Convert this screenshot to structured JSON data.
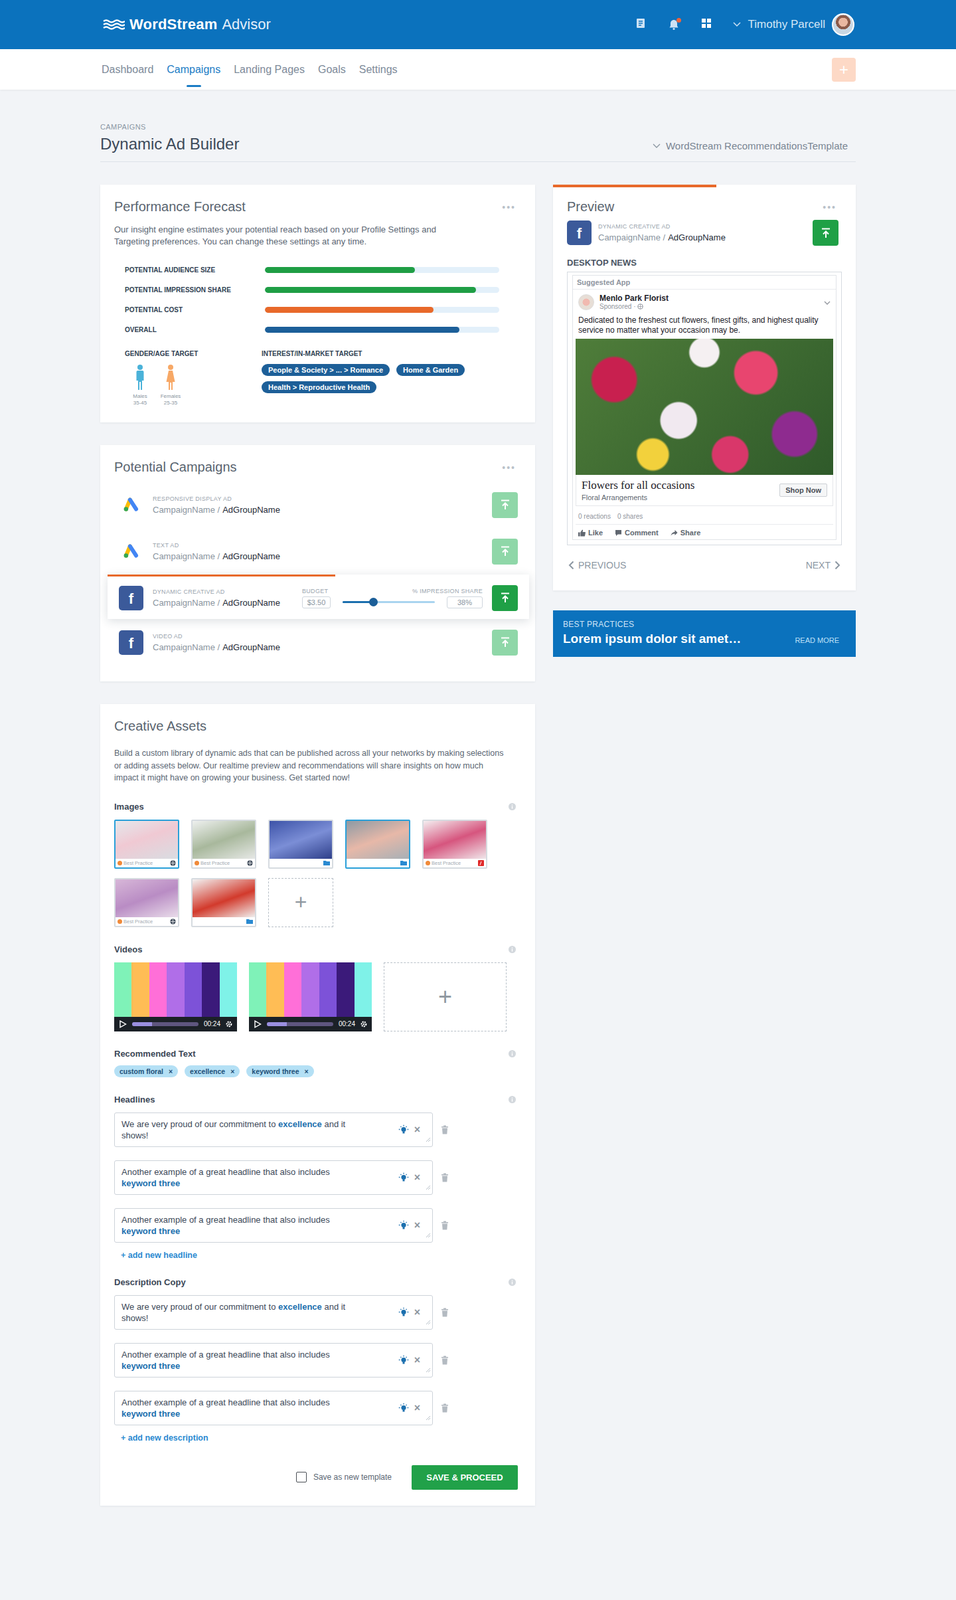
{
  "topbar": {
    "logo_bold": "WordStream",
    "logo_light": "Advisor",
    "user": "Timothy Parcell",
    "notification_unread": true
  },
  "nav": {
    "tabs": [
      {
        "label": "Dashboard",
        "selected": false
      },
      {
        "label": "Campaigns",
        "selected": true
      },
      {
        "label": "Landing Pages",
        "selected": false
      },
      {
        "label": "Goals",
        "selected": false
      },
      {
        "label": "Settings",
        "selected": false
      }
    ],
    "action": "+"
  },
  "header": {
    "breadcrumb": "CAMPAIGNS",
    "title": "Dynamic Ad Builder",
    "template": "WordStream RecommendationsTemplate"
  },
  "forecast": {
    "title": "Performance Forecast",
    "more": "•••",
    "description": "Our insight engine estimates your potential reach based on your Profile Settings and Targeting preferences. You can change these settings at any time.",
    "metrics": [
      {
        "label": "POTENTIAL AUDIENCE SIZE",
        "level": 0.64,
        "color": "#1f9e45"
      },
      {
        "label": "POTENTIAL IMPRESSION SHARE",
        "level": 0.9,
        "color": "#1f9e45"
      },
      {
        "label": "POTENTIAL COST",
        "level": 0.72,
        "color": "#e8692a"
      },
      {
        "label": "OVERALL",
        "level": 0.83,
        "color": "#1c5f99"
      }
    ],
    "gender_title": "GENDER/AGE TARGET",
    "genders": [
      {
        "label": "Males",
        "age": "35-45",
        "color": "#4ab2d9"
      },
      {
        "label": "Females",
        "age": "25-35",
        "color": "#f7a866"
      }
    ],
    "interest_title": "INTEREST/IN-MARKET TARGET",
    "interests": [
      "People & Society > ... > Romance",
      "Home & Garden",
      "Health > Reproductive Health"
    ]
  },
  "campaigns": {
    "title": "Potential Campaigns",
    "more": "•••",
    "items": [
      {
        "kind": "google",
        "type": "RESPONSIVE DISPLAY AD",
        "campaign": "CampaignName /",
        "ad_group": "AdGroupName",
        "selected": false
      },
      {
        "kind": "google",
        "type": "TEXT AD",
        "campaign": "CampaignName /",
        "ad_group": "AdGroupName",
        "selected": false
      },
      {
        "kind": "facebook",
        "icon": "f",
        "type": "DYNAMIC CREATIVE AD",
        "campaign": "CampaignName /",
        "ad_group": "AdGroupName",
        "selected": true,
        "progress": 0.54,
        "budget_label": "BUDGET",
        "budget": "$3.50",
        "budget_level": 0.34,
        "share_label": "% IMPRESSION SHARE",
        "share": "38%"
      },
      {
        "kind": "facebook",
        "icon": "f",
        "type": "VIDEO AD",
        "campaign": "CampaignName /",
        "ad_group": "AdGroupName",
        "selected": false
      }
    ]
  },
  "preview": {
    "progress": 0.54,
    "title": "Preview",
    "more": "•••",
    "ad": {
      "icon": "f",
      "type": "DYNAMIC CREATIVE AD",
      "campaign": "CampaignName /",
      "ad_group": "AdGroupName"
    },
    "placement": "DESKTOP NEWS",
    "post": {
      "suggested": "Suggested App",
      "page": "Menlo Park Florist",
      "sponsored": "Sponsored ·",
      "text": "Dedicated to the freshest cut flowers, finest gifts, and highest quality service no matter what your occasion may be.",
      "link_title": "Flowers for all occasions",
      "link_caption": "Floral Arrangements",
      "cta": "Shop Now",
      "reactions": "0 reactions",
      "shares": "0 shares",
      "actions": [
        "Like",
        "Comment",
        "Share"
      ]
    },
    "previous": "PREVIOUS",
    "next": "NEXT"
  },
  "best_practices": {
    "label": "BEST PRACTICES",
    "text": "Lorem ipsum dolor sit amet…",
    "link": "READ MORE"
  },
  "creative": {
    "title": "Creative Assets",
    "description": "Build a custom library of dynamic ads that can be published across all your networks by making selections or adding assets below. Our realtime preview and recommendations will share insights on how much impact it might have on growing your business. Get started now!",
    "images": {
      "title": "Images",
      "add": "+",
      "items": [
        {
          "selected": true,
          "badge": "Best Practice",
          "kind": "web"
        },
        {
          "selected": false,
          "badge": "Best Practice",
          "kind": "web"
        },
        {
          "selected": false,
          "kind": "folder"
        },
        {
          "selected": true,
          "kind": "folder"
        },
        {
          "selected": false,
          "badge": "Best Practice",
          "kind": "pinterest"
        },
        {
          "selected": false,
          "badge": "Best Practice",
          "kind": "web"
        },
        {
          "selected": false,
          "kind": "folder"
        }
      ]
    },
    "videos": {
      "title": "Videos",
      "add": "+",
      "items": [
        {
          "time": "00:24",
          "level": 0.3
        },
        {
          "time": "00:24",
          "level": 0.3
        }
      ]
    },
    "recommended": {
      "title": "Recommended Text",
      "remove": "×",
      "chips": [
        "custom floral",
        "excellence",
        "keyword three"
      ]
    },
    "headlines": {
      "title": "Headlines",
      "clear": "×",
      "add": "+ add new headline",
      "fields": [
        {
          "parts": [
            {
              "text": "We are very proud of our commitment to ",
              "keyword": false
            },
            {
              "text": "excellence",
              "keyword": true
            },
            {
              "text": " and it shows!",
              "keyword": false
            }
          ]
        },
        {
          "parts": [
            {
              "text": "Another example of a great headline that also includes ",
              "keyword": false
            },
            {
              "text": "keyword three",
              "keyword": true
            }
          ]
        },
        {
          "parts": [
            {
              "text": "Another example of a great headline that also includes ",
              "keyword": false
            },
            {
              "text": "keyword three",
              "keyword": true
            }
          ]
        }
      ]
    },
    "descriptions": {
      "title": "Description Copy",
      "clear": "×",
      "add": "+ add new description",
      "fields": [
        {
          "parts": [
            {
              "text": "We are very proud of our commitment to ",
              "keyword": false
            },
            {
              "text": "excellence",
              "keyword": true
            },
            {
              "text": " and it shows!",
              "keyword": false
            }
          ]
        },
        {
          "parts": [
            {
              "text": "Another example of a great headline that also includes ",
              "keyword": false
            },
            {
              "text": "keyword three",
              "keyword": true
            }
          ]
        },
        {
          "parts": [
            {
              "text": "Another example of a great headline that also includes ",
              "keyword": false
            },
            {
              "text": "keyword three",
              "keyword": true
            }
          ]
        }
      ]
    },
    "save_template": {
      "label": "Save as new template",
      "checked": false
    },
    "submit": "SAVE & PROCEED"
  }
}
